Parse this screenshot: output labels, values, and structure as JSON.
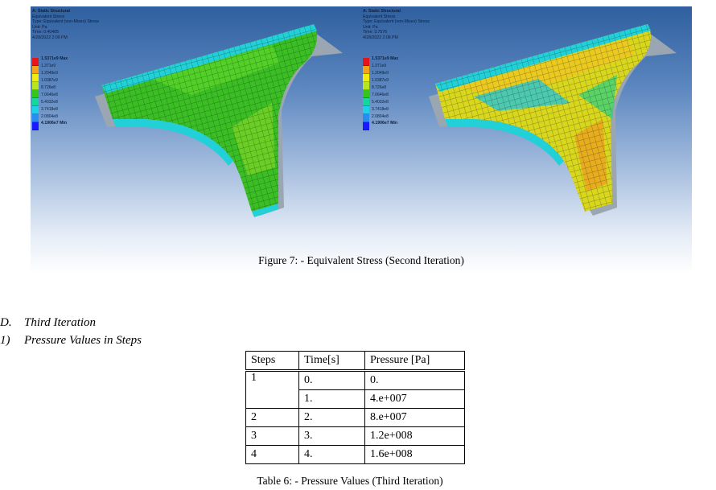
{
  "figure": {
    "caption": "Figure 7: - Equivalent Stress (Second Iteration)",
    "panels": [
      {
        "title": "A: Static Structural",
        "result": "Equivalent Stress",
        "type": "Type: Equivalent (von-Mises) Stress",
        "unit": "Unit: Pa",
        "time": "Time: 0.40405",
        "date": "4/28/2022 2:09 PM",
        "max_label": "1.5371e9 Max",
        "min_label": "4.1906e7 Min",
        "ticks": [
          "1.371e9",
          "1.2049e9",
          "1.0387e9",
          "8.726e8",
          "7.0646e8",
          "5.4032e8",
          "3.7418e8",
          "2.0804e8"
        ]
      },
      {
        "title": "A: Static Structural",
        "result": "Equivalent Stress",
        "type": "Type: Equivalent (von-Mises) Stress",
        "unit": "Unit: Pa",
        "time": "Time: 3.7576",
        "date": "4/28/2022 2:08 PM",
        "max_label": "1.5371e9 Max",
        "min_label": "4.1906e7 Min",
        "ticks": [
          "1.371e9",
          "1.2049e9",
          "1.0387e9",
          "8.726e8",
          "7.0646e8",
          "5.4032e8",
          "3.7418e8",
          "2.0804e8"
        ]
      }
    ],
    "legend_colors": [
      "#e8141b",
      "#f2a31a",
      "#eded10",
      "#b7e520",
      "#36c51a",
      "#16d6a0",
      "#20cfe8",
      "#2a8cf0",
      "#1a1aff"
    ]
  },
  "section_d": {
    "number": "D.",
    "title": "Third Iteration"
  },
  "subsection_1": {
    "number": "1)",
    "title": "Pressure Values in Steps"
  },
  "table": {
    "headers": [
      "Steps",
      "Time[s]",
      "Pressure [Pa]"
    ],
    "rows": [
      [
        "1",
        "0.",
        "0."
      ],
      [
        "",
        "1.",
        "4.e+007"
      ],
      [
        "2",
        "2.",
        "8.e+007"
      ],
      [
        "3",
        "3.",
        "1.2e+008"
      ],
      [
        "4",
        "4.",
        "1.6e+008"
      ]
    ],
    "caption": "Table 6: - Pressure Values (Third Iteration)"
  }
}
